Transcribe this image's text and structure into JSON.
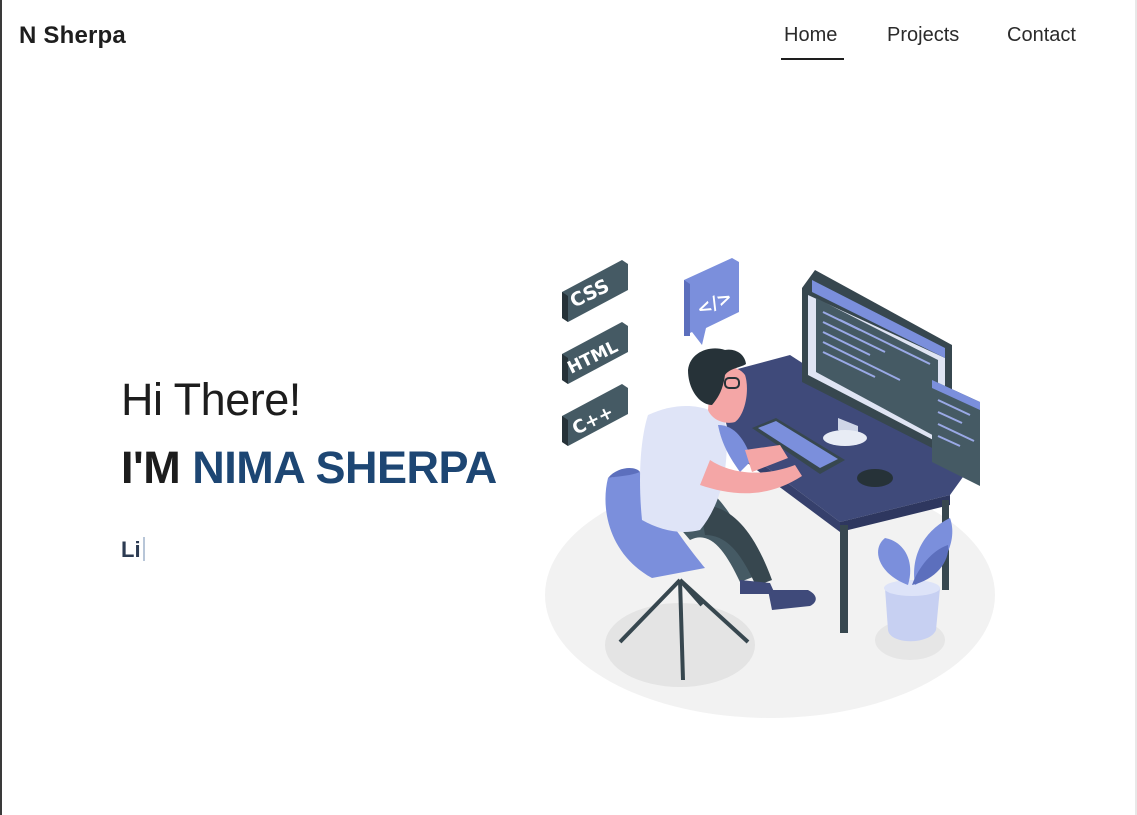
{
  "navbar": {
    "brand": "N Sherpa",
    "links": [
      {
        "label": "Home",
        "active": true
      },
      {
        "label": "Projects",
        "active": false
      },
      {
        "label": "Contact",
        "active": false
      }
    ]
  },
  "hero": {
    "greeting": "Hi There!",
    "intro_prefix": "I'M ",
    "name": "NIMA SHERPA",
    "typing_text": "Li"
  },
  "illustration": {
    "tags": [
      "CSS",
      "HTML",
      "C++"
    ],
    "code_bubble": "</>"
  },
  "colors": {
    "accent": "#1d4673",
    "illustration_primary": "#7b8fdc",
    "desk": "#3f4a7a",
    "dark": "#37474f"
  }
}
